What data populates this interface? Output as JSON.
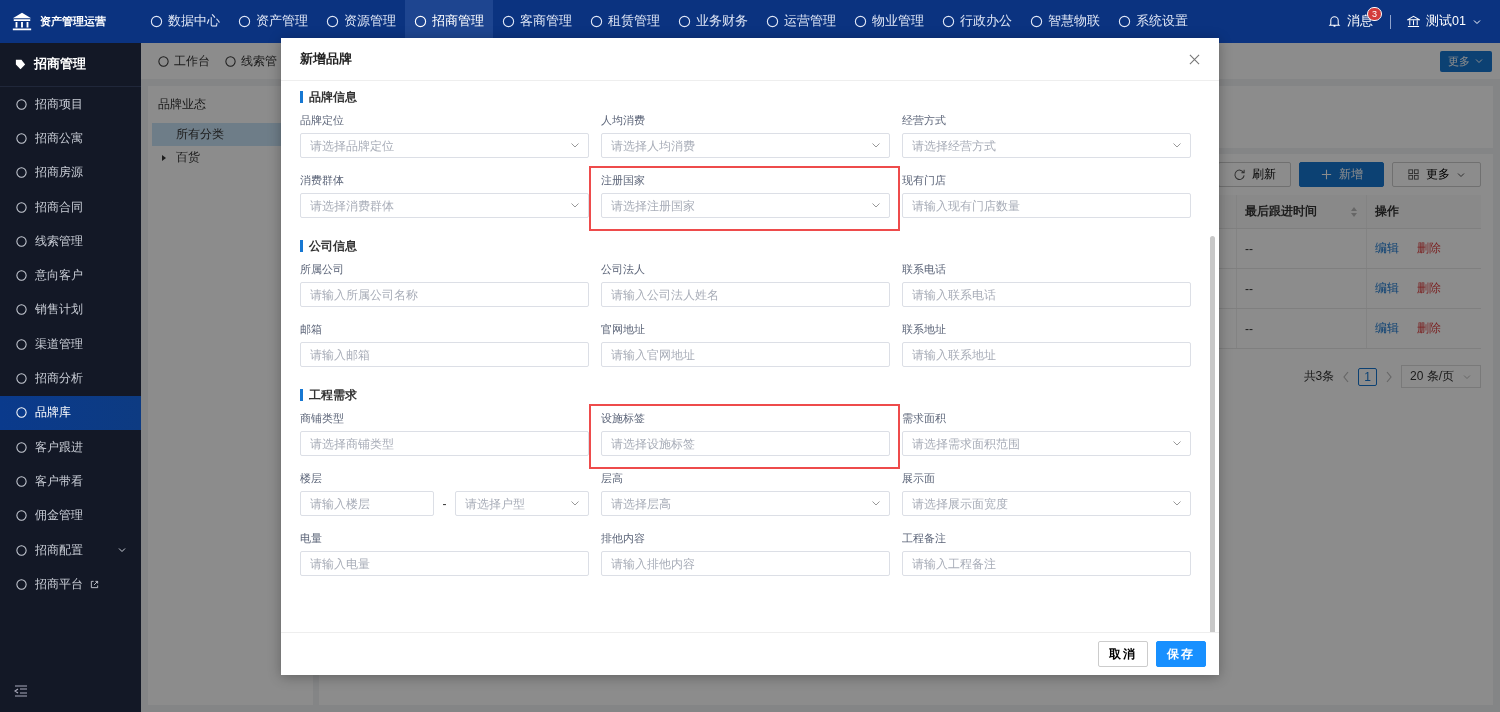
{
  "app": {
    "title": "资产管理运营"
  },
  "nav": [
    {
      "label": "数据中心",
      "selected": false
    },
    {
      "label": "资产管理",
      "selected": false
    },
    {
      "label": "资源管理",
      "selected": false
    },
    {
      "label": "招商管理",
      "selected": true
    },
    {
      "label": "客商管理",
      "selected": false
    },
    {
      "label": "租赁管理",
      "selected": false
    },
    {
      "label": "业务财务",
      "selected": false
    },
    {
      "label": "运营管理",
      "selected": false
    },
    {
      "label": "物业管理",
      "selected": false
    },
    {
      "label": "行政办公",
      "selected": false
    },
    {
      "label": "智慧物联",
      "selected": false
    },
    {
      "label": "系统设置",
      "selected": false
    }
  ],
  "header_right": {
    "messages": {
      "label": "消息",
      "badge": "3"
    },
    "user": {
      "name": "测试01"
    }
  },
  "sidebar": {
    "title": "招商管理",
    "items": [
      {
        "label": "招商项目",
        "selected": false,
        "kind": "link"
      },
      {
        "label": "招商公寓",
        "selected": false,
        "kind": "link"
      },
      {
        "label": "招商房源",
        "selected": false,
        "kind": "link"
      },
      {
        "label": "招商合同",
        "selected": false,
        "kind": "link"
      },
      {
        "label": "线索管理",
        "selected": false,
        "kind": "link"
      },
      {
        "label": "意向客户",
        "selected": false,
        "kind": "link"
      },
      {
        "label": "销售计划",
        "selected": false,
        "kind": "link"
      },
      {
        "label": "渠道管理",
        "selected": false,
        "kind": "link"
      },
      {
        "label": "招商分析",
        "selected": false,
        "kind": "link"
      },
      {
        "label": "品牌库",
        "selected": true,
        "kind": "link"
      },
      {
        "label": "客户跟进",
        "selected": false,
        "kind": "link"
      },
      {
        "label": "客户带看",
        "selected": false,
        "kind": "link"
      },
      {
        "label": "佣金管理",
        "selected": false,
        "kind": "link"
      },
      {
        "label": "招商配置",
        "selected": false,
        "kind": "group",
        "expanded": false
      },
      {
        "label": "招商平台",
        "selected": false,
        "kind": "external"
      }
    ]
  },
  "tabs": [
    {
      "label": "工作台"
    },
    {
      "label": "线索管"
    }
  ],
  "more_button": "更多",
  "tree": {
    "title": "品牌业态",
    "items": [
      {
        "label": "所有分类",
        "selected": true
      },
      {
        "label": "百货",
        "selected": false,
        "expanded": false
      }
    ]
  },
  "toolbar": {
    "buttons": [
      {
        "label": "刷新",
        "kind": "refresh"
      },
      {
        "label": "新增",
        "kind": "primary"
      },
      {
        "label": "更多",
        "kind": "more"
      }
    ]
  },
  "table": {
    "columns": [
      {
        "label": "最后跟进时间",
        "sortable": true
      },
      {
        "label": "操作",
        "sortable": false
      }
    ],
    "rows": [
      {
        "last_follow_up": "--",
        "actions": [
          "编辑",
          "删除"
        ]
      },
      {
        "last_follow_up": "--",
        "actions": [
          "编辑",
          "删除"
        ]
      },
      {
        "last_follow_up": "--",
        "actions": [
          "编辑",
          "删除"
        ]
      }
    ]
  },
  "pagination": {
    "total": "共3条",
    "pages": [
      {
        "label": "1",
        "selected": true
      }
    ],
    "page_size": "20 条/页"
  },
  "dialog": {
    "title": "新增品牌",
    "sections": [
      {
        "title": "品牌信息",
        "fields": [
          {
            "label": "品牌定位",
            "kind": "select",
            "placeholder": "请选择品牌定位",
            "highlighted": false
          },
          {
            "label": "人均消费",
            "kind": "select",
            "placeholder": "请选择人均消费",
            "highlighted": false
          },
          {
            "label": "经营方式",
            "kind": "select",
            "placeholder": "请选择经营方式",
            "highlighted": false
          },
          {
            "label": "消费群体",
            "kind": "select",
            "placeholder": "请选择消费群体",
            "highlighted": false
          },
          {
            "label": "注册国家",
            "kind": "select",
            "placeholder": "请选择注册国家",
            "highlighted": true
          },
          {
            "label": "现有门店",
            "kind": "input",
            "placeholder": "请输入现有门店数量",
            "highlighted": false
          }
        ]
      },
      {
        "title": "公司信息",
        "fields": [
          {
            "label": "所属公司",
            "kind": "input",
            "placeholder": "请输入所属公司名称",
            "highlighted": false
          },
          {
            "label": "公司法人",
            "kind": "input",
            "placeholder": "请输入公司法人姓名",
            "highlighted": false
          },
          {
            "label": "联系电话",
            "kind": "input",
            "placeholder": "请输入联系电话",
            "highlighted": false
          },
          {
            "label": "邮箱",
            "kind": "input",
            "placeholder": "请输入邮箱",
            "highlighted": false
          },
          {
            "label": "官网地址",
            "kind": "input",
            "placeholder": "请输入官网地址",
            "highlighted": false
          },
          {
            "label": "联系地址",
            "kind": "input",
            "placeholder": "请输入联系地址",
            "highlighted": false
          }
        ]
      },
      {
        "title": "工程需求",
        "fields": [
          {
            "label": "商铺类型",
            "kind": "input",
            "placeholder": "请选择商铺类型",
            "highlighted": false
          },
          {
            "label": "设施标签",
            "kind": "input",
            "placeholder": "请选择设施标签",
            "highlighted": true
          },
          {
            "label": "需求面积",
            "kind": "select",
            "placeholder": "请选择需求面积范围",
            "highlighted": false
          },
          {
            "label": "楼层",
            "kind": "pair",
            "first": {
              "kind": "input",
              "placeholder": "请输入楼层"
            },
            "separator": "-",
            "second": {
              "kind": "select",
              "placeholder": "请选择户型"
            },
            "highlighted": false
          },
          {
            "label": "层高",
            "kind": "select",
            "placeholder": "请选择层高",
            "highlighted": false
          },
          {
            "label": "展示面",
            "kind": "select",
            "placeholder": "请选择展示面宽度",
            "highlighted": false
          },
          {
            "label": "电量",
            "kind": "input",
            "placeholder": "请输入电量",
            "highlighted": false
          },
          {
            "label": "排他内容",
            "kind": "input",
            "placeholder": "请输入排他内容",
            "highlighted": false
          },
          {
            "label": "工程备注",
            "kind": "input",
            "placeholder": "请输入工程备注",
            "highlighted": false
          }
        ]
      }
    ],
    "buttons": [
      {
        "label": "取消",
        "kind": "default"
      },
      {
        "label": "保存",
        "kind": "primary"
      }
    ]
  }
}
